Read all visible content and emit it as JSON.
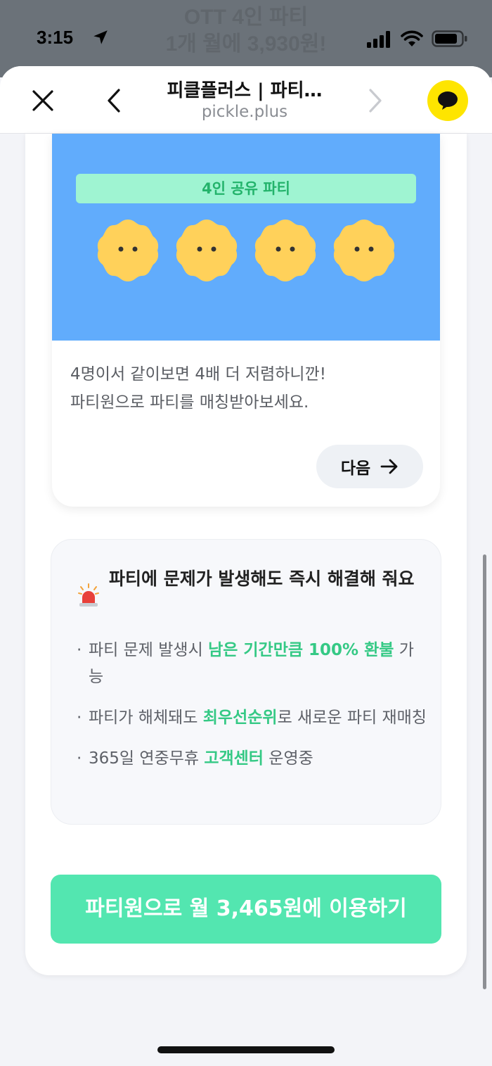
{
  "status_bar": {
    "time": "3:15",
    "icons": [
      "location-arrow-icon",
      "signal-icon",
      "wifi-icon",
      "battery-icon"
    ]
  },
  "background_banner": {
    "line1": "OTT 4인 파티",
    "line2": "1개 월에 3,930원!"
  },
  "browser": {
    "title": "피클플러스 | 파티…",
    "url": "pickle.plus",
    "buttons": [
      "close-icon",
      "back-icon",
      "forward-icon",
      "kakao-chat-icon"
    ]
  },
  "card_party": {
    "badge": "4인 공유 파티",
    "description_line1": "4명이서 같이보면 4배 더 저렴하니깐!",
    "description_line2": "파티원으로 파티를 매칭받아보세요.",
    "next_label": "다음",
    "colors": {
      "hero": "#61acfc",
      "badge_bg": "#9ff4d2",
      "badge_text": "#23b36b",
      "cookie": "#ffd15a"
    }
  },
  "card_guarantee": {
    "icon": "siren-icon",
    "title": "파티에 문제가 발생해도 즉시 해결해 줘요",
    "bullets": [
      {
        "pre": "파티 문제 발생시 ",
        "highlight": "남은 기간만큼 100% 환불",
        "post": " 가능"
      },
      {
        "pre": "파티가 해체돼도 ",
        "highlight": "최우선순위",
        "post": "로 새로운 파티 재매칭"
      },
      {
        "pre": "365일 연중무휴 ",
        "highlight": "고객센터",
        "post": " 운영중"
      }
    ],
    "highlight_color": "#35c985"
  },
  "cta": {
    "label": "파티원으로 월 3,465원에 이용하기",
    "color": "#53e6b0"
  }
}
